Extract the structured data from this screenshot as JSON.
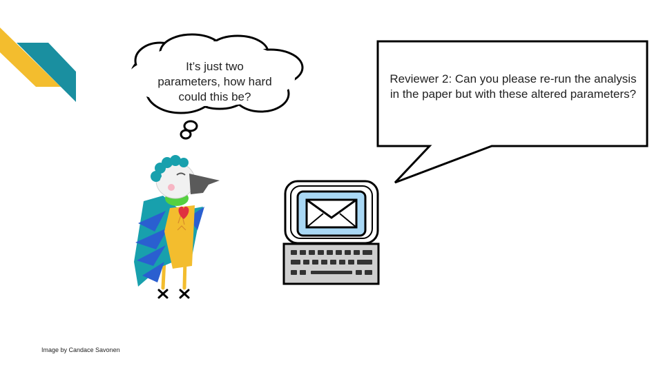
{
  "thought_bubble": {
    "text": "It’s just two parameters, how hard could this be?"
  },
  "speech_bubble": {
    "text": "Reviewer 2: Can you please re-run the analysis in the paper but with these altered parameters?"
  },
  "credit": "Image by Candace Savonen",
  "colors": {
    "accent_yellow": "#f3bd2e",
    "accent_teal": "#1a8fa0",
    "screen_blue": "#a9d8f5"
  },
  "icons": [
    "corner-accent-stripes",
    "thought-cloud",
    "speech-bubble",
    "parrot-illustration",
    "computer-icon",
    "envelope-icon",
    "keyboard-icon"
  ]
}
